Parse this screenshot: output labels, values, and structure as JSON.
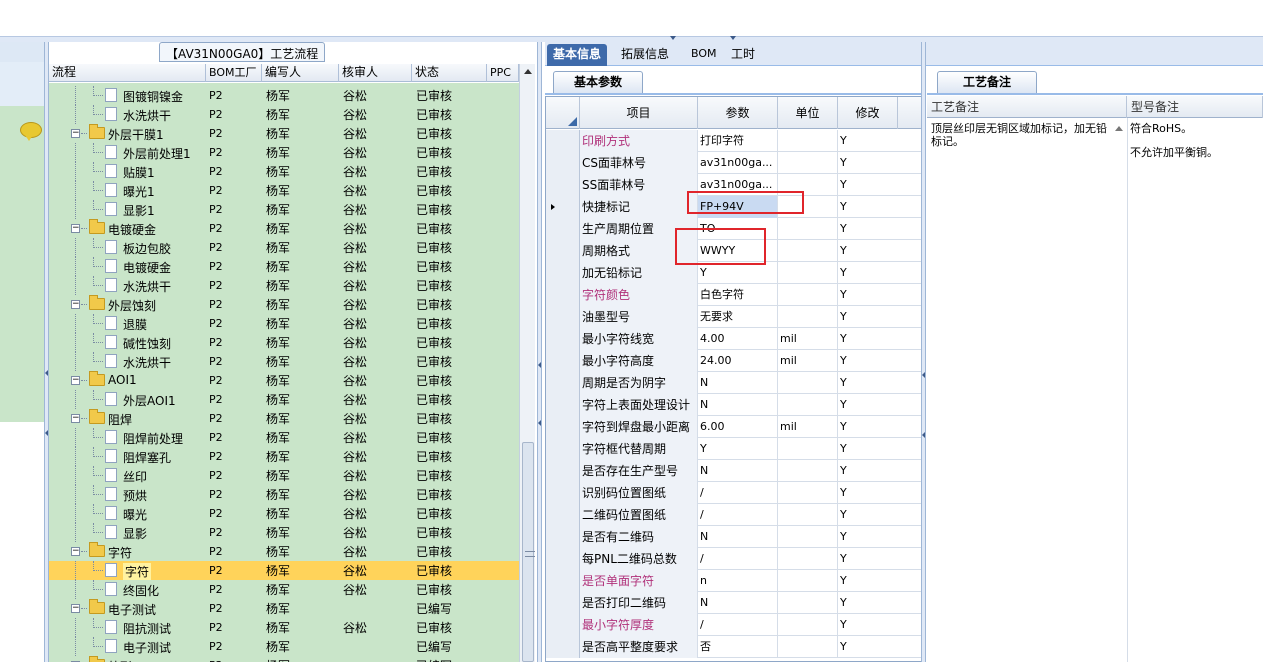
{
  "tree": {
    "title": "【AV31N00GA0】工艺流程",
    "headers": [
      "流程",
      "BOM工厂",
      "编写人",
      "核审人",
      "状态",
      "PPC"
    ],
    "rows": [
      {
        "name": "图镀铜镍金",
        "level": 2,
        "type": "doc",
        "bom": "P2",
        "writer": "杨军",
        "reviewer": "谷松",
        "status": "已审核"
      },
      {
        "name": "水洗烘干",
        "level": 2,
        "type": "doc",
        "bom": "P2",
        "writer": "杨军",
        "reviewer": "谷松",
        "status": "已审核"
      },
      {
        "name": "外层干膜1",
        "level": 1,
        "type": "folder",
        "bom": "P2",
        "writer": "杨军",
        "reviewer": "谷松",
        "status": "已审核"
      },
      {
        "name": "外层前处理1",
        "level": 2,
        "type": "doc",
        "bom": "P2",
        "writer": "杨军",
        "reviewer": "谷松",
        "status": "已审核"
      },
      {
        "name": "贴膜1",
        "level": 2,
        "type": "doc",
        "bom": "P2",
        "writer": "杨军",
        "reviewer": "谷松",
        "status": "已审核"
      },
      {
        "name": "曝光1",
        "level": 2,
        "type": "doc",
        "bom": "P2",
        "writer": "杨军",
        "reviewer": "谷松",
        "status": "已审核"
      },
      {
        "name": "显影1",
        "level": 2,
        "type": "doc",
        "bom": "P2",
        "writer": "杨军",
        "reviewer": "谷松",
        "status": "已审核"
      },
      {
        "name": "电镀硬金",
        "level": 1,
        "type": "folder",
        "bom": "P2",
        "writer": "杨军",
        "reviewer": "谷松",
        "status": "已审核"
      },
      {
        "name": "板边包胶",
        "level": 2,
        "type": "doc",
        "bom": "P2",
        "writer": "杨军",
        "reviewer": "谷松",
        "status": "已审核"
      },
      {
        "name": "电镀硬金",
        "level": 2,
        "type": "doc",
        "bom": "P2",
        "writer": "杨军",
        "reviewer": "谷松",
        "status": "已审核"
      },
      {
        "name": "水洗烘干",
        "level": 2,
        "type": "doc",
        "bom": "P2",
        "writer": "杨军",
        "reviewer": "谷松",
        "status": "已审核"
      },
      {
        "name": "外层蚀刻",
        "level": 1,
        "type": "folder",
        "bom": "P2",
        "writer": "杨军",
        "reviewer": "谷松",
        "status": "已审核"
      },
      {
        "name": "退膜",
        "level": 2,
        "type": "doc",
        "bom": "P2",
        "writer": "杨军",
        "reviewer": "谷松",
        "status": "已审核"
      },
      {
        "name": "碱性蚀刻",
        "level": 2,
        "type": "doc",
        "bom": "P2",
        "writer": "杨军",
        "reviewer": "谷松",
        "status": "已审核"
      },
      {
        "name": "水洗烘干",
        "level": 2,
        "type": "doc",
        "bom": "P2",
        "writer": "杨军",
        "reviewer": "谷松",
        "status": "已审核"
      },
      {
        "name": "AOI1",
        "level": 1,
        "type": "folder",
        "bom": "P2",
        "writer": "杨军",
        "reviewer": "谷松",
        "status": "已审核"
      },
      {
        "name": "外层AOI1",
        "level": 2,
        "type": "doc",
        "bom": "P2",
        "writer": "杨军",
        "reviewer": "谷松",
        "status": "已审核"
      },
      {
        "name": "阻焊",
        "level": 1,
        "type": "folder",
        "bom": "P2",
        "writer": "杨军",
        "reviewer": "谷松",
        "status": "已审核"
      },
      {
        "name": "阻焊前处理",
        "level": 2,
        "type": "doc",
        "bom": "P2",
        "writer": "杨军",
        "reviewer": "谷松",
        "status": "已审核"
      },
      {
        "name": "阻焊塞孔",
        "level": 2,
        "type": "doc",
        "bom": "P2",
        "writer": "杨军",
        "reviewer": "谷松",
        "status": "已审核"
      },
      {
        "name": "丝印",
        "level": 2,
        "type": "doc",
        "bom": "P2",
        "writer": "杨军",
        "reviewer": "谷松",
        "status": "已审核"
      },
      {
        "name": "预烘",
        "level": 2,
        "type": "doc",
        "bom": "P2",
        "writer": "杨军",
        "reviewer": "谷松",
        "status": "已审核"
      },
      {
        "name": "曝光",
        "level": 2,
        "type": "doc",
        "bom": "P2",
        "writer": "杨军",
        "reviewer": "谷松",
        "status": "已审核"
      },
      {
        "name": "显影",
        "level": 2,
        "type": "doc",
        "bom": "P2",
        "writer": "杨军",
        "reviewer": "谷松",
        "status": "已审核"
      },
      {
        "name": "字符",
        "level": 1,
        "type": "folder",
        "bom": "P2",
        "writer": "杨军",
        "reviewer": "谷松",
        "status": "已审核"
      },
      {
        "name": "字符",
        "level": 2,
        "type": "doc",
        "bom": "P2",
        "writer": "杨军",
        "reviewer": "谷松",
        "status": "已审核",
        "selected": true
      },
      {
        "name": "终固化",
        "level": 2,
        "type": "doc",
        "bom": "P2",
        "writer": "杨军",
        "reviewer": "谷松",
        "status": "已审核"
      },
      {
        "name": "电子测试",
        "level": 1,
        "type": "folder",
        "bom": "P2",
        "writer": "杨军",
        "reviewer": "",
        "status": "已编写"
      },
      {
        "name": "阻抗测试",
        "level": 2,
        "type": "doc",
        "bom": "P2",
        "writer": "杨军",
        "reviewer": "谷松",
        "status": "已审核"
      },
      {
        "name": "电子测试",
        "level": 2,
        "type": "doc",
        "bom": "P2",
        "writer": "杨军",
        "reviewer": "",
        "status": "已编写"
      },
      {
        "name": "外形",
        "level": 1,
        "type": "folder",
        "bom": "P2",
        "writer": "杨军",
        "reviewer": "",
        "status": "已编写"
      }
    ]
  },
  "tabs": [
    "基本信息",
    "拓展信息",
    "BOM",
    "工时"
  ],
  "grid": {
    "subtab": "基本参数",
    "headers": {
      "item": "项目",
      "param": "参数",
      "unit": "单位",
      "modify": "修改"
    },
    "rows": [
      {
        "item": "印刷方式",
        "param": "打印字符",
        "unit": "",
        "modify": "Y",
        "pink": true
      },
      {
        "item": "CS面菲林号",
        "param": "av31n00ga...",
        "unit": "",
        "modify": "Y"
      },
      {
        "item": "SS面菲林号",
        "param": "av31n00ga...",
        "unit": "",
        "modify": "Y"
      },
      {
        "item": "快捷标记",
        "param": "FP+94V",
        "unit": "",
        "modify": "Y",
        "current": true
      },
      {
        "item": "生产周期位置",
        "param": "TO",
        "unit": "",
        "modify": "Y"
      },
      {
        "item": "周期格式",
        "param": "WWYY",
        "unit": "",
        "modify": "Y"
      },
      {
        "item": "加无铅标记",
        "param": "Y",
        "unit": "",
        "modify": "Y"
      },
      {
        "item": "字符颜色",
        "param": "白色字符",
        "unit": "",
        "modify": "Y",
        "pink": true
      },
      {
        "item": "油墨型号",
        "param": "无要求",
        "unit": "",
        "modify": "Y"
      },
      {
        "item": "最小字符线宽",
        "param": "4.00",
        "unit": "mil",
        "modify": "Y"
      },
      {
        "item": "最小字符高度",
        "param": "24.00",
        "unit": "mil",
        "modify": "Y"
      },
      {
        "item": "周期是否为阴字",
        "param": "N",
        "unit": "",
        "modify": "Y"
      },
      {
        "item": "字符上表面处理设计",
        "param": "N",
        "unit": "",
        "modify": "Y"
      },
      {
        "item": "字符到焊盘最小距离",
        "param": "6.00",
        "unit": "mil",
        "modify": "Y"
      },
      {
        "item": "字符框代替周期",
        "param": "Y",
        "unit": "",
        "modify": "Y"
      },
      {
        "item": "是否存在生产型号",
        "param": "N",
        "unit": "",
        "modify": "Y"
      },
      {
        "item": "识别码位置图纸",
        "param": "/",
        "unit": "",
        "modify": "Y"
      },
      {
        "item": "二维码位置图纸",
        "param": "/",
        "unit": "",
        "modify": "Y"
      },
      {
        "item": "是否有二维码",
        "param": "N",
        "unit": "",
        "modify": "Y"
      },
      {
        "item": "每PNL二维码总数",
        "param": "/",
        "unit": "",
        "modify": "Y"
      },
      {
        "item": "是否单面字符",
        "param": "n",
        "unit": "",
        "modify": "Y",
        "pink": true
      },
      {
        "item": "是否打印二维码",
        "param": "N",
        "unit": "",
        "modify": "Y"
      },
      {
        "item": "最小字符厚度",
        "param": "/",
        "unit": "",
        "modify": "Y",
        "pink": true
      },
      {
        "item": "是否高平整度要求",
        "param": "否",
        "unit": "",
        "modify": "Y"
      }
    ]
  },
  "notes": {
    "subtab": "工艺备注",
    "headers": [
      "工艺备注",
      "型号备注"
    ],
    "process_note": "顶层丝印层无铜区域加标记，加无铅标记。",
    "model_note_1": "符合RoHS。",
    "model_note_2": "不允许加平衡铜。"
  },
  "colors": {
    "tree_bg": "#c9e5c9",
    "selected_row": "#ffd35a",
    "active_tab": "#3e6aaa",
    "highlight_box": "#e0252b",
    "pink_text": "#b0317a"
  }
}
